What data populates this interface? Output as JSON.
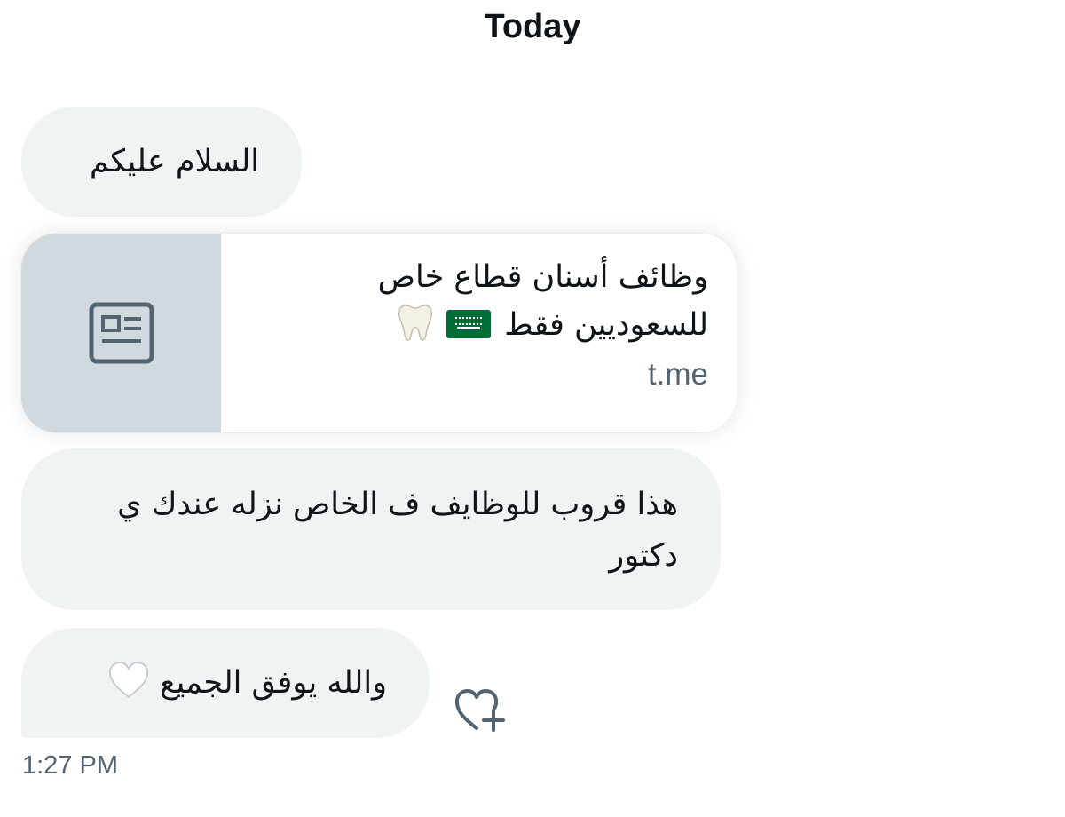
{
  "date_header": "Today",
  "messages": [
    {
      "text": "السلام عليكم"
    },
    {
      "link_card": {
        "title_line1": "وظائف أسنان قطاع خاص",
        "title_line2": "للسعوديين فقط",
        "emojis": [
          "saudi-flag-icon",
          "tooth-icon"
        ],
        "domain": "t.me",
        "thumbnail_icon": "article-icon"
      }
    },
    {
      "text": "هذا قروب للوظايف ف الخاص نزله عندك ي دكتور"
    },
    {
      "text": "والله يوفق الجميع",
      "emoji": "white-heart-icon"
    }
  ],
  "reaction_button_icon": "heart-plus-icon",
  "timestamp": "1:27 PM",
  "colors": {
    "bubble_bg": "#eff3f4",
    "text": "#0f1419",
    "secondary_text": "#536471",
    "thumb_bg": "#cfd9de",
    "flag_green": "#006c35"
  }
}
